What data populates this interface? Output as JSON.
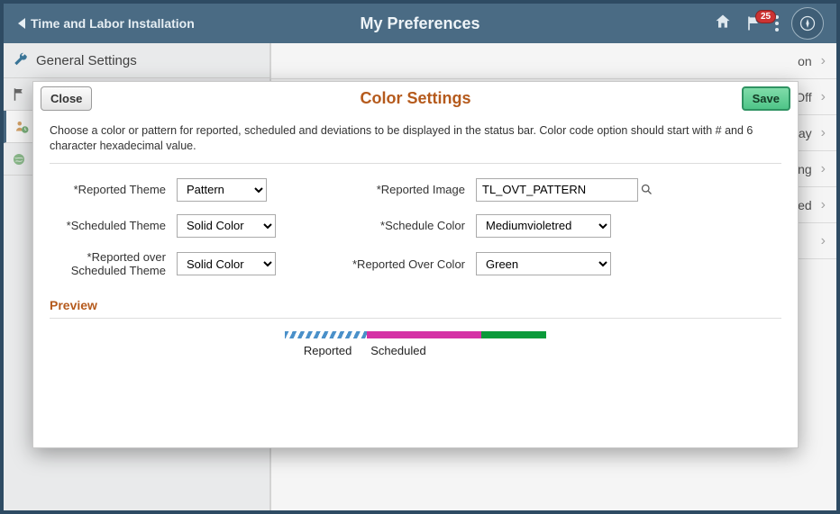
{
  "topbar": {
    "back_label": "Time and Labor Installation",
    "title": "My Preferences",
    "notification_count": "25"
  },
  "sidebar": {
    "general_settings_label": "General Settings"
  },
  "right_peek": {
    "items": [
      "on",
      "Off",
      "ay",
      "ng",
      "ed",
      ""
    ]
  },
  "modal": {
    "title": "Color Settings",
    "close_label": "Close",
    "save_label": "Save",
    "helper_text": "Choose a color or pattern for reported, scheduled and deviations to be displayed in the status bar. Color code option should start with # and 6 character hexadecimal value.",
    "labels": {
      "reported_theme": "*Reported Theme",
      "scheduled_theme": "*Scheduled Theme",
      "reported_over_scheduled_theme": "*Reported over Scheduled Theme",
      "reported_image": "*Reported Image",
      "schedule_color": "*Schedule Color",
      "reported_over_color": "*Reported Over Color"
    },
    "values": {
      "reported_theme": "Pattern",
      "scheduled_theme": "Solid Color",
      "reported_over_scheduled_theme": "Solid Color",
      "reported_image": "TL_OVT_PATTERN",
      "schedule_color": "Mediumvioletred",
      "reported_over_color": "Green"
    },
    "preview": {
      "title": "Preview",
      "reported_label": "Reported",
      "scheduled_label": "Scheduled"
    }
  }
}
